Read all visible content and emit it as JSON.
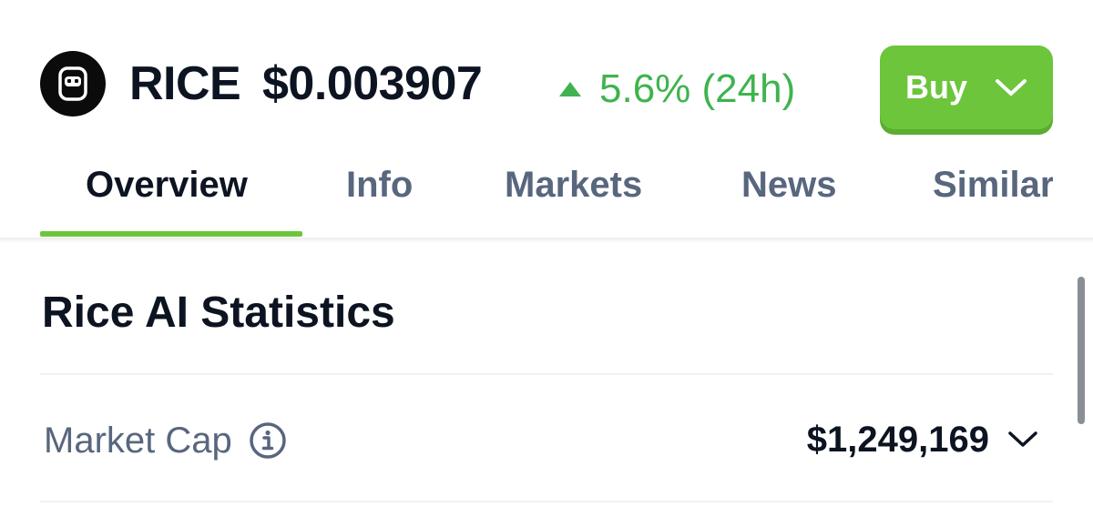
{
  "header": {
    "logo_icon": "rice-ai-robot-logo-icon",
    "symbol": "RICE",
    "price": "$0.003907",
    "change_icon": "triangle-up-icon",
    "change": "5.6% (24h)",
    "change_color": "#3fb34f",
    "buy_label": "Buy",
    "buy_color": "#6cc53b"
  },
  "tabs": [
    {
      "label": "Overview",
      "active": true
    },
    {
      "label": "Info",
      "active": false
    },
    {
      "label": "Markets",
      "active": false
    },
    {
      "label": "News",
      "active": false
    },
    {
      "label": "Similar",
      "active": false
    }
  ],
  "statistics": {
    "title": "Rice AI Statistics",
    "rows": [
      {
        "label": "Market Cap",
        "info_icon": "info-circle-icon",
        "value": "$1,249,169",
        "expand_icon": "chevron-down-icon"
      }
    ]
  }
}
